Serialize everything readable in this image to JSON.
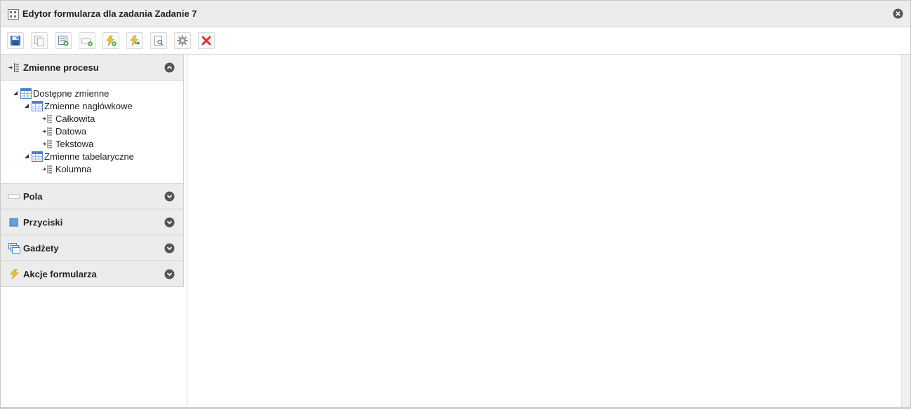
{
  "window": {
    "title": "Edytor formularza dla zadania Zadanie 7",
    "icons": {
      "app": "form-editor-icon",
      "close": "close-circle-icon"
    }
  },
  "toolbar": {
    "buttons": [
      {
        "name": "save",
        "icon": "floppy-disk-icon"
      },
      {
        "name": "copy",
        "icon": "copy-pages-icon"
      },
      {
        "name": "add-form",
        "icon": "add-form-icon"
      },
      {
        "name": "add-field",
        "icon": "add-field-icon"
      },
      {
        "name": "add-action",
        "icon": "add-action-icon"
      },
      {
        "name": "next-action",
        "icon": "action-arrow-icon"
      },
      {
        "name": "preview",
        "icon": "preview-icon"
      },
      {
        "name": "settings",
        "icon": "gear-icon"
      },
      {
        "name": "delete",
        "icon": "delete-x-icon"
      }
    ],
    "delete_color": "#e03030"
  },
  "sidebar": {
    "sections": [
      {
        "label": "Zmienne procesu",
        "expanded": true,
        "icon": "process-variables-icon"
      },
      {
        "label": "Pola",
        "expanded": false,
        "icon": "field-icon"
      },
      {
        "label": "Przyciski",
        "expanded": false,
        "icon": "button-square-icon"
      },
      {
        "label": "Gadżety",
        "expanded": false,
        "icon": "widgets-icon"
      },
      {
        "label": "Akcje formularza",
        "expanded": false,
        "icon": "lightning-icon"
      }
    ],
    "tree": [
      {
        "label": "Dostępne zmienne",
        "level": 0,
        "type": "table",
        "expanded": true
      },
      {
        "label": "Zmienne nagłówkowe",
        "level": 1,
        "type": "table",
        "expanded": true
      },
      {
        "label": "Całkowita",
        "level": 2,
        "type": "variable"
      },
      {
        "label": "Datowa",
        "level": 2,
        "type": "variable"
      },
      {
        "label": "Tekstowa",
        "level": 2,
        "type": "variable"
      },
      {
        "label": "Zmienne tabelaryczne",
        "level": 1,
        "type": "table",
        "expanded": true
      },
      {
        "label": "Kolumna",
        "level": 2,
        "type": "variable"
      }
    ]
  },
  "colors": {
    "accent_blue": "#4a7fd0",
    "header_bg": "#ececec"
  }
}
